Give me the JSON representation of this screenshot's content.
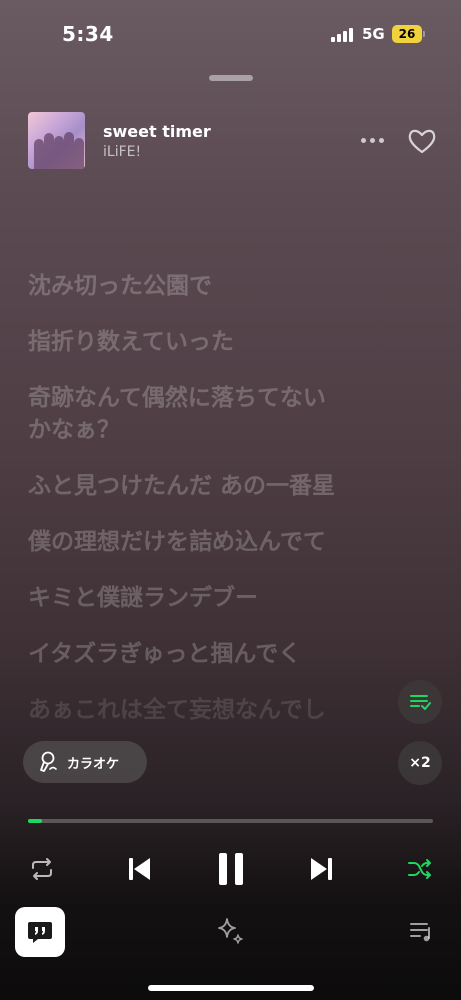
{
  "status": {
    "time": "5:34",
    "network": "5G",
    "battery": "26"
  },
  "track": {
    "title": "sweet timer",
    "artist": "iLiFE!",
    "liked": false
  },
  "lyrics": [
    "沈み切った公園で",
    "指折り数えていった",
    "奇跡なんて偶然に落ちてない\nかなぁ？",
    "ふと見つけたんだ あの一番星",
    "僕の理想だけを詰め込んでて",
    "キミと僕謎ランデブー",
    "イタズラぎゅっと掴んでく",
    "あぁこれは全て妄想なんでし"
  ],
  "karaoke": {
    "label": "カラオケ"
  },
  "playback": {
    "speed_label": "×2",
    "progress_fraction": 0.035,
    "is_playing": true,
    "shuffle_active": true,
    "accent_color": "#1ed760"
  },
  "icons": {
    "repeat": "repeat-icon",
    "previous": "skip-previous-icon",
    "pause": "pause-icon",
    "next": "skip-next-icon",
    "shuffle": "shuffle-icon",
    "lyrics": "lyrics-quote-icon",
    "sparkle": "sparkle-icon",
    "queue": "queue-list-icon"
  }
}
